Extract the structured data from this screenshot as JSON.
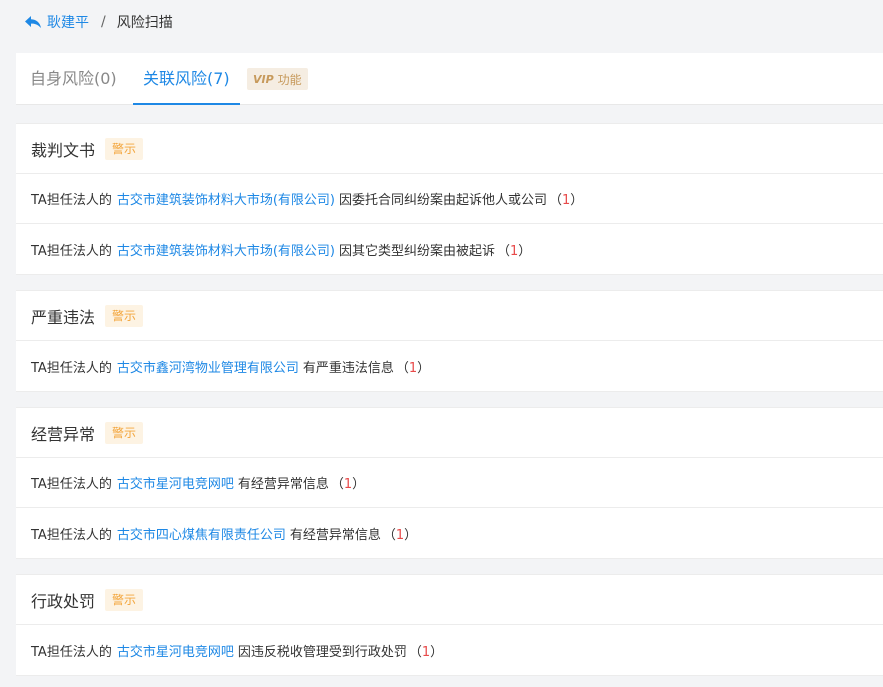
{
  "breadcrumb": {
    "back_label": "耿建平",
    "separator": "/",
    "current": "风险扫描"
  },
  "tabs": {
    "items": [
      {
        "label": "自身风险(0)"
      },
      {
        "label": "关联风险(7)"
      }
    ],
    "vip": {
      "mark": "VIP",
      "label": "功能"
    }
  },
  "sections": [
    {
      "title": "裁判文书",
      "tag": "警示",
      "rows": [
        {
          "prefix": "TA担任法人的",
          "company": "古交市建筑装饰材料大市场(有限公司)",
          "desc": "因委托合同纠纷案由起诉他人或公司",
          "count": "1"
        },
        {
          "prefix": "TA担任法人的",
          "company": "古交市建筑装饰材料大市场(有限公司)",
          "desc": "因其它类型纠纷案由被起诉",
          "count": "1"
        }
      ]
    },
    {
      "title": "严重违法",
      "tag": "警示",
      "rows": [
        {
          "prefix": "TA担任法人的",
          "company": "古交市鑫河湾物业管理有限公司",
          "desc": "有严重违法信息",
          "count": "1"
        }
      ]
    },
    {
      "title": "经营异常",
      "tag": "警示",
      "rows": [
        {
          "prefix": "TA担任法人的",
          "company": "古交市星河电竞网吧",
          "desc": "有经营异常信息",
          "count": "1"
        },
        {
          "prefix": "TA担任法人的",
          "company": "古交市四心煤焦有限责任公司",
          "desc": "有经营异常信息",
          "count": "1"
        }
      ]
    },
    {
      "title": "行政处罚",
      "tag": "警示",
      "rows": [
        {
          "prefix": "TA担任法人的",
          "company": "古交市星河电竞网吧",
          "desc": "因违反税收管理受到行政处罚",
          "count": "1"
        }
      ]
    }
  ],
  "colors": {
    "accent": "#1e88e5",
    "warning": "#f3a53b",
    "count": "#e84a4a",
    "vip": "#c79a5c"
  },
  "icons": {
    "back": "reply-arrow-icon"
  }
}
